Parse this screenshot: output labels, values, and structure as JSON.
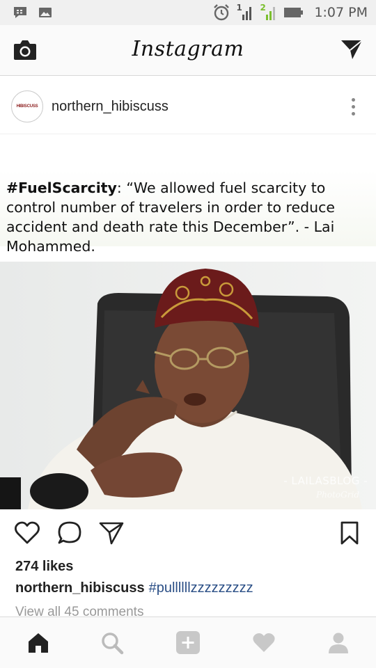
{
  "status_bar": {
    "sim1": "1",
    "sim2": "2",
    "time": "1:07 PM"
  },
  "app_bar": {
    "logo": "Instagram",
    "camera_icon": "camera-icon",
    "direct_icon": "paper-plane-icon"
  },
  "post": {
    "username": "northern_hibiscuss",
    "avatar_text": "HIBISCUSS",
    "image": {
      "quote_tag": "#FuelScarcity",
      "quote_text": ": “We allowed fuel scarcity to control number of travelers in order to reduce accident and death rate this December”. - Lai Mohammed.",
      "watermark": "- LAILASBLOG -",
      "watermark_sub": "PhotoGrid"
    },
    "likes": "274 likes",
    "caption_user": "northern_hibiscuss",
    "caption_hashtag": "#pullllllzzzzzzzzz",
    "view_comments": "View all 45 comments"
  },
  "bottom_nav": {
    "items": [
      "home-icon",
      "search-icon",
      "add-icon",
      "heart-icon",
      "profile-icon"
    ]
  },
  "colors": {
    "hashtag": "#2b4f86",
    "status_green": "#7bbf2e"
  }
}
